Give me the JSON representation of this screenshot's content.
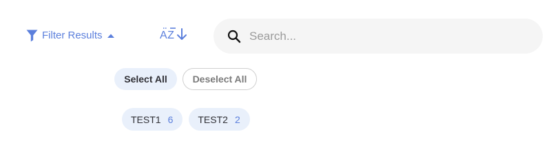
{
  "colors": {
    "accent": "#5b7fdc",
    "text_dark": "#2f2f35",
    "text_muted": "#7a7a7a",
    "search_bg": "#f5f5f5",
    "placeholder": "#9b9b9b",
    "pill_bg": "#e9f0fb",
    "pill_border": "#cfcfcf"
  },
  "filter_toggle": {
    "label": "Filter Results",
    "icon": "funnel-icon",
    "caret_icon": "caret-up-icon"
  },
  "sort": {
    "label": "AZ",
    "icon": "arrow-down-icon"
  },
  "search": {
    "placeholder": "Search...",
    "value": "",
    "icon": "search-icon"
  },
  "actions": {
    "select_all": "Select All",
    "deselect_all": "Deselect All"
  },
  "filters": [
    {
      "label": "TEST1",
      "count": "6"
    },
    {
      "label": "TEST2",
      "count": "2"
    }
  ]
}
